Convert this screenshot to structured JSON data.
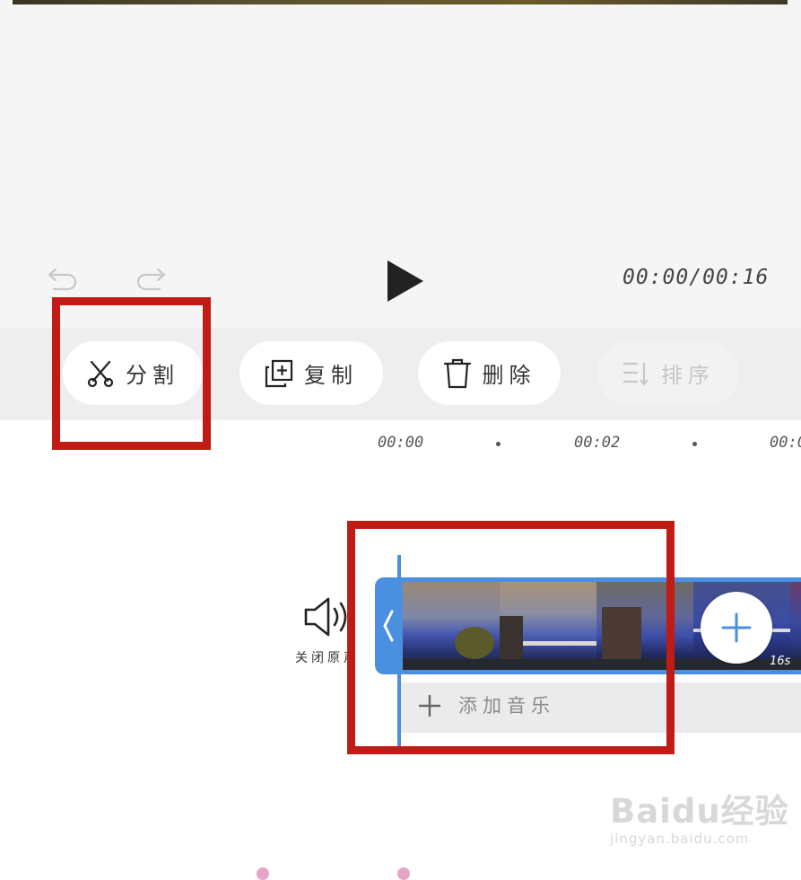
{
  "player": {
    "time_display": "00:00/00:16",
    "icons": {
      "undo": "undo-icon",
      "redo": "redo-icon",
      "play": "play-icon"
    }
  },
  "toolbar": {
    "split_label": "分割",
    "copy_label": "复制",
    "delete_label": "删除",
    "sort_label": "排序",
    "icons": {
      "split": "scissors-icon",
      "copy": "copy-icon",
      "delete": "trash-icon",
      "sort": "sort-icon"
    }
  },
  "ruler": {
    "labels": [
      "00:00",
      "00:02",
      "00:0"
    ]
  },
  "audio": {
    "mute_label": "关闭原声",
    "icon": "speaker-icon"
  },
  "timeline": {
    "clip_duration": "16s",
    "add_music_label": "添加音乐",
    "icons": {
      "handle": "chevron-left-icon",
      "add_clip": "plus-icon",
      "add_music": "plus-icon"
    }
  },
  "colors": {
    "accent": "#4a8fe0",
    "highlight": "#c01b14",
    "toolbar_band": "#eeeeee"
  },
  "watermark": {
    "logo": "Baidu经验",
    "url": "jingyan.baidu.com"
  }
}
